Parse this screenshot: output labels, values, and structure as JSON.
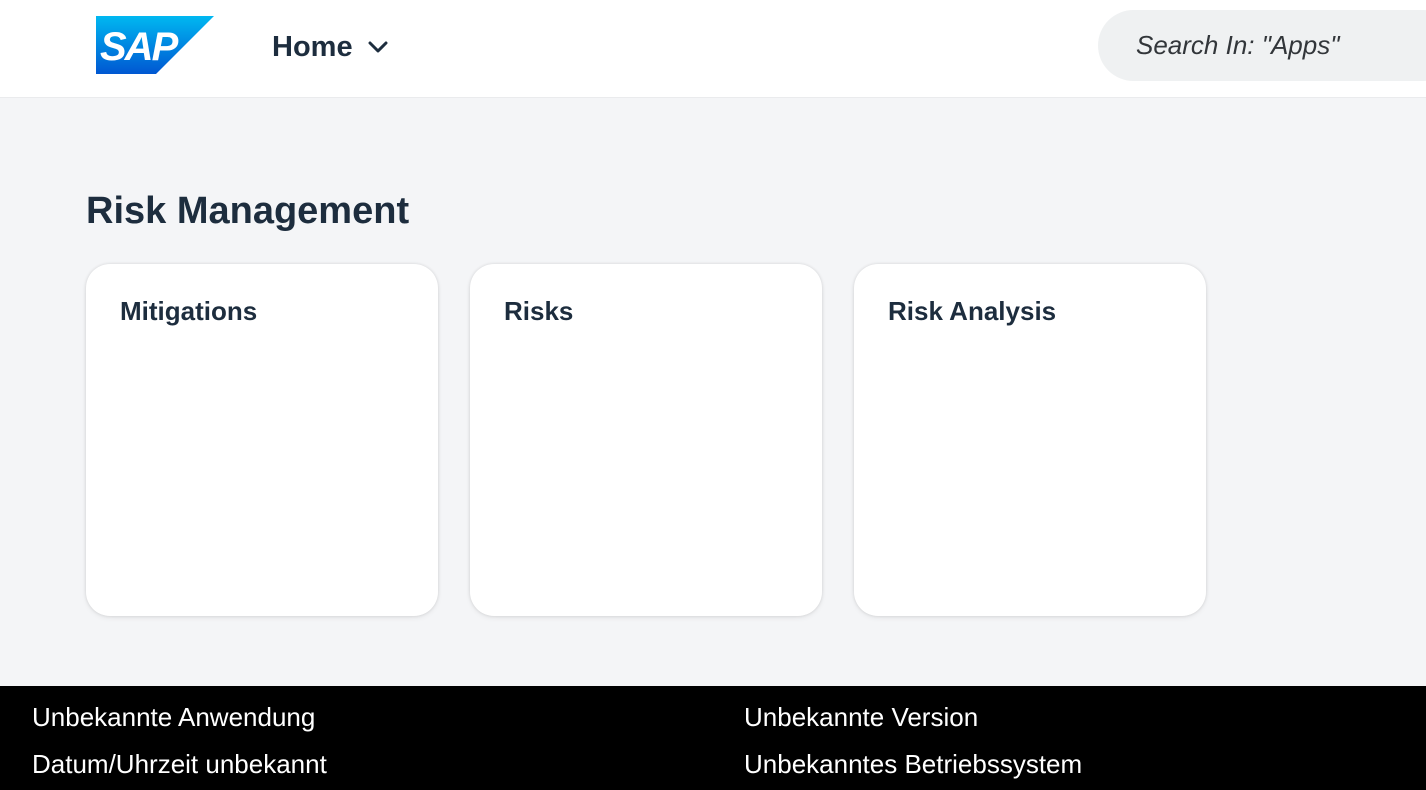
{
  "header": {
    "logo_text": "SAP",
    "title": "Home",
    "title_icon": "chevron-down-icon",
    "search": {
      "placeholder": "Search In: \"Apps\""
    }
  },
  "main": {
    "group_title": "Risk Management",
    "tiles": [
      {
        "title": "Mitigations"
      },
      {
        "title": "Risks"
      },
      {
        "title": "Risk Analysis"
      }
    ]
  },
  "footer": {
    "application": "Unbekannte Anwendung",
    "datetime": "Datum/Uhrzeit unbekannt",
    "version": "Unbekannte Version",
    "os": "Unbekanntes Betriebssystem"
  },
  "colors": {
    "brand_logo_blue": "#0a6ed1",
    "text": "#1d2d3e",
    "background": "#f4f5f7",
    "footer_bg": "#000000"
  }
}
